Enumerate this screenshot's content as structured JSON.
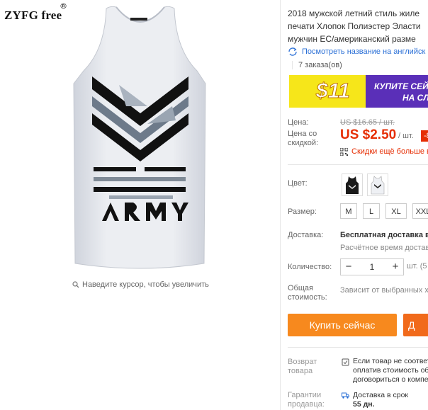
{
  "brand": {
    "name": "ZYFG free",
    "mark": "®"
  },
  "zoom_hint": "Наведите курсор, чтобы увеличить",
  "title": [
    "2018 мужской летний стиль жиле",
    "печати Хлопок Полиэстер Эласти",
    "мужчин ЕС/американский разме"
  ],
  "translate_link": "Посмотреть название на английск",
  "orders": "7 заказа(ов)",
  "banner": {
    "amount": "$11",
    "text": [
      "КУПИТЕ СЕЙ",
      "НА СЛ"
    ]
  },
  "price": {
    "label": "Цена:",
    "old": "US $16.65 / шт.",
    "discount_label": [
      "Цена со",
      "скидкой:"
    ],
    "current": "US $2.50",
    "unit": "/ шт.",
    "badge": "-8",
    "coupon": "Скидки ещё больше в"
  },
  "color": {
    "label": "Цвет:"
  },
  "size": {
    "label": "Размер:",
    "options": [
      "M",
      "L",
      "XL",
      "XXL"
    ]
  },
  "shipping": {
    "label": "Доставка:",
    "main": "Бесплатная доставка в R",
    "time": "Расчётное время доставк"
  },
  "quantity": {
    "label": "Количество:",
    "minus": "−",
    "value": "1",
    "plus": "+",
    "note": "шт. (5 н"
  },
  "total": {
    "label": [
      "Общая",
      "стоимость:"
    ],
    "note": "Зависит от выбранных ха"
  },
  "buttons": {
    "buy_now": "Купить сейчас",
    "add_to_cart": "Д"
  },
  "returns": {
    "label": [
      "Возврат",
      "товара"
    ],
    "text": [
      "Если товар не соответ",
      "оплатив стоимость об",
      "договориться о компе"
    ]
  },
  "guarantee": {
    "label": [
      "Гарантии",
      "продавца:"
    ],
    "text": [
      "Доставка в срок",
      "55 дн."
    ]
  },
  "colors": {
    "price_red": "#e62e04",
    "link_blue": "#2a6fd6",
    "buy_orange": "#f7891e",
    "cart_orange": "#f16a1b",
    "banner_purple": "#5a2fb8",
    "banner_yellow": "#f6e61a"
  }
}
